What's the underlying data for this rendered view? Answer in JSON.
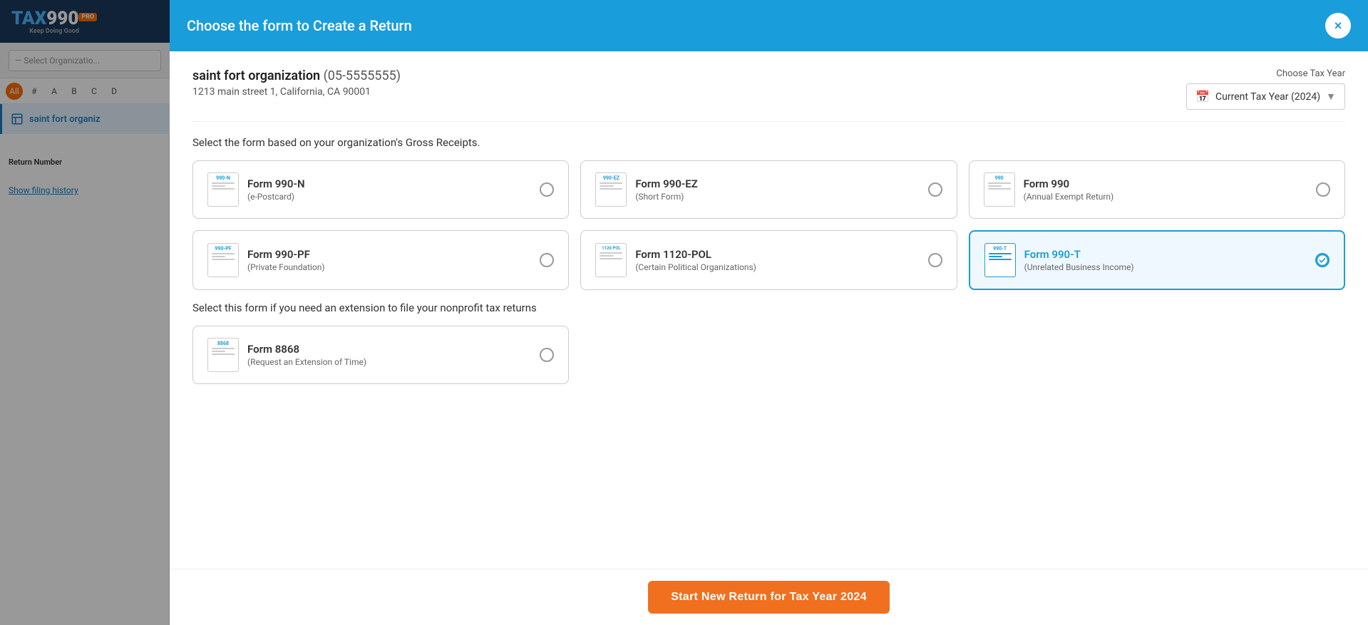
{
  "app": {
    "logo_tax": "TAX",
    "logo_990": "990",
    "logo_pro": "PRO",
    "logo_tagline": "Keep Doing Good"
  },
  "sidebar": {
    "search_placeholder": "— Select Organizatio...",
    "alpha_buttons": [
      "All",
      "#",
      "A",
      "B",
      "C",
      "D"
    ],
    "active_alpha": "All",
    "org_name": "saint fort organiz",
    "return_number_label": "Return Number",
    "show_filing_history": "Show filing history"
  },
  "modal": {
    "title": "Choose the form to Create a Return",
    "close_label": "×",
    "org_name": "saint fort organization",
    "org_ein": "(05-5555555)",
    "org_address": "1213 main street 1, California, CA 90001",
    "tax_year_label": "Choose Tax Year",
    "tax_year_value": "Current Tax Year (2024)",
    "gross_receipts_label": "Select the form based on your organization's Gross Receipts.",
    "forms": [
      {
        "id": "990n",
        "icon_label": "990-N",
        "name": "Form 990-N",
        "desc": "(e-Postcard)",
        "selected": false
      },
      {
        "id": "990ez",
        "icon_label": "990-\nEZ",
        "name": "Form 990-EZ",
        "desc": "(Short Form)",
        "selected": false
      },
      {
        "id": "990",
        "icon_label": "990",
        "name": "Form 990",
        "desc": "(Annual Exempt Return)",
        "selected": false
      },
      {
        "id": "990pf",
        "icon_label": "990-\nPF",
        "name": "Form 990-PF",
        "desc": "(Private Foundation)",
        "selected": false
      },
      {
        "id": "1120pol",
        "icon_label": "1120\nPOL",
        "name": "Form 1120-POL",
        "desc": "(Certain Political Organizations)",
        "selected": false
      },
      {
        "id": "990t",
        "icon_label": "990-T",
        "name": "Form 990-T",
        "desc": "(Unrelated Business Income)",
        "selected": true
      }
    ],
    "extension_label": "Select this form if you need an extension to file your nonprofit tax returns",
    "extension_forms": [
      {
        "id": "8868",
        "icon_label": "8868",
        "name": "Form 8868",
        "desc": "(Request an Extension of Time)",
        "selected": false
      }
    ],
    "start_button_label": "Start New Return for Tax Year 2024"
  }
}
